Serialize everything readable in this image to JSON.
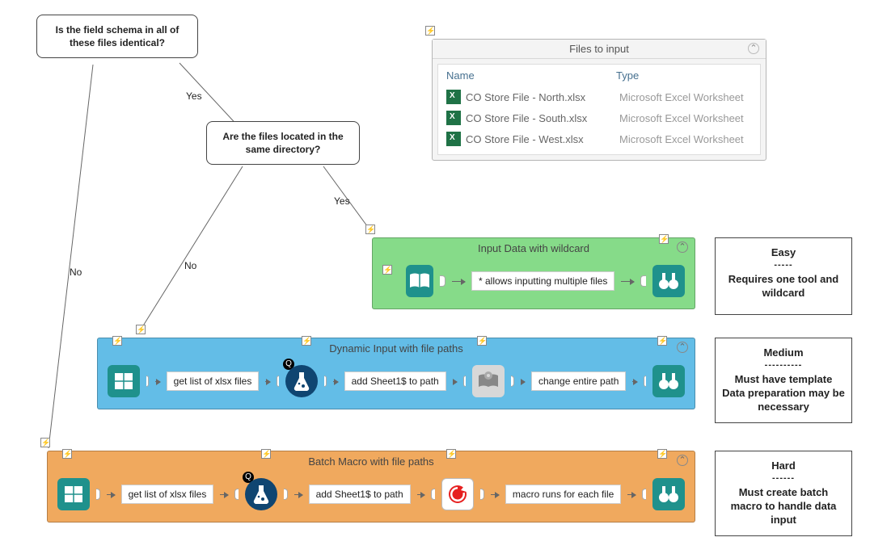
{
  "decisions": {
    "schema": "Is the field schema in all of these files identical?",
    "directory": "Are the files located in the same directory?"
  },
  "edges": {
    "yes1": "Yes",
    "no1": "No",
    "yes2": "Yes",
    "no2": "No"
  },
  "files_panel": {
    "title": "Files to input",
    "columns": {
      "name": "Name",
      "type": "Type"
    },
    "rows": [
      {
        "name": "CO Store File - North.xlsx",
        "type": "Microsoft Excel Worksheet"
      },
      {
        "name": "CO Store File - South.xlsx",
        "type": "Microsoft Excel Worksheet"
      },
      {
        "name": "CO Store File - West.xlsx",
        "type": "Microsoft Excel Worksheet"
      }
    ]
  },
  "methods": {
    "easy": {
      "title": "Input Data with wildcard",
      "chip": "* allows inputting multiple files"
    },
    "medium": {
      "title": "Dynamic Input with file paths",
      "chips": [
        "get list of xlsx files",
        "add Sheet1$ to path",
        "change entire path"
      ]
    },
    "hard": {
      "title": "Batch Macro with file paths",
      "chips": [
        "get list of xlsx files",
        "add Sheet1$ to path",
        "macro runs for each file"
      ]
    }
  },
  "cards": {
    "easy": {
      "level": "Easy",
      "dash": "-----",
      "desc": "Requires one tool and wildcard"
    },
    "medium": {
      "level": "Medium",
      "dash": "----------",
      "desc": "Must have template Data preparation may be necessary"
    },
    "hard": {
      "level": "Hard",
      "dash": "------",
      "desc": "Must create batch macro to handle data input"
    }
  },
  "icons": {
    "input": "book-open-icon",
    "browse": "binoculars-icon",
    "directory": "directory-icon",
    "formula": "flask-icon",
    "dynamic": "book-gear-icon",
    "macro": "refresh-icon"
  }
}
